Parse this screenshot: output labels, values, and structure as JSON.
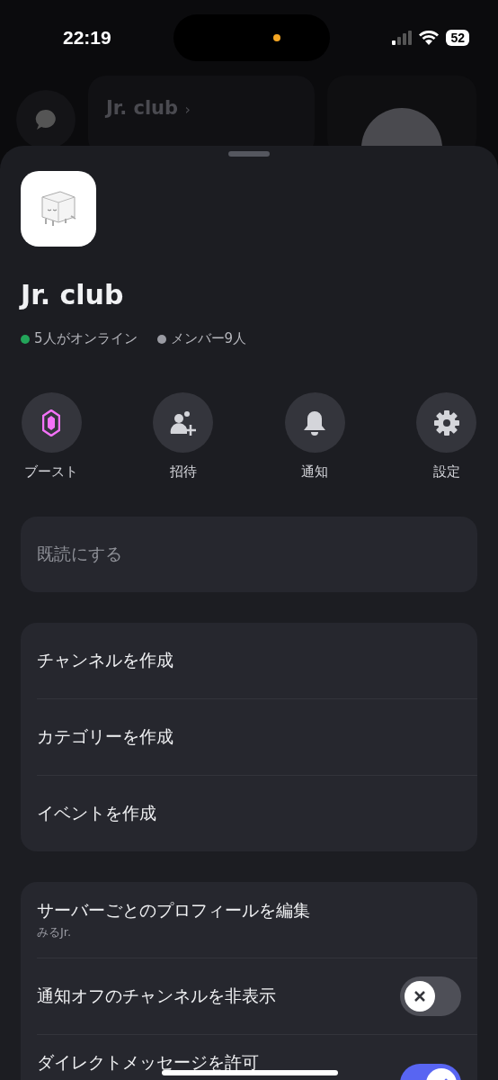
{
  "status_bar": {
    "time": "22:19",
    "battery": "52"
  },
  "background": {
    "server_name": "Jr. club",
    "chevron": "›"
  },
  "sheet": {
    "server_name": "Jr. club",
    "stats": [
      {
        "text": "5人がオンライン",
        "color": "#23a55a"
      },
      {
        "text": "メンバー9人",
        "color": "#9a9ba3"
      }
    ],
    "actions": [
      {
        "kind": "boost",
        "label": "ブースト"
      },
      {
        "kind": "invite",
        "label": "招待"
      },
      {
        "kind": "notify",
        "label": "通知"
      },
      {
        "kind": "settings",
        "label": "設定"
      }
    ],
    "mark_read": {
      "label": "既読にする"
    },
    "create_items": [
      {
        "label": "チャンネルを作成"
      },
      {
        "label": "カテゴリーを作成"
      },
      {
        "label": "イベントを作成"
      }
    ],
    "settings": [
      {
        "kind": "link",
        "label": "サーバーごとのプロフィールを編集",
        "subtitle": "みるJr."
      },
      {
        "kind": "toggle",
        "label": "通知オフのチャンネルを非表示",
        "on": false
      },
      {
        "kind": "toggle",
        "label": "ダイレクトメッセージを許可",
        "on": true
      }
    ]
  }
}
